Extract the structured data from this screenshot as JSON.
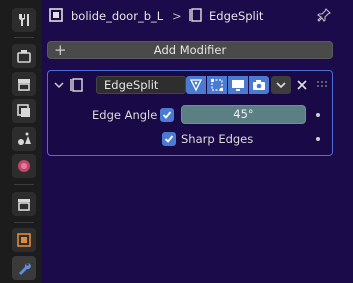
{
  "header": {
    "object_name": "bolide_door_b_L",
    "breadcrumb_separator": ">",
    "modifier_name": "EdgeSplit"
  },
  "toolbar": {
    "add_modifier_label": "Add Modifier"
  },
  "modifier": {
    "name": "EdgeSplit",
    "edge_angle_label": "Edge Angle",
    "edge_angle_enabled": true,
    "edge_angle_value": "45°",
    "sharp_edges_label": "Sharp Edges",
    "sharp_edges_enabled": true
  },
  "sidebar": {
    "tabs": [
      {
        "icon": "tool-icon"
      },
      {
        "icon": "render-icon"
      },
      {
        "icon": "output-icon"
      },
      {
        "icon": "view-layer-icon"
      },
      {
        "icon": "scene-icon"
      },
      {
        "icon": "world-icon"
      },
      {
        "icon": "collection-icon"
      },
      {
        "icon": "object-icon"
      },
      {
        "icon": "modifier-wrench-icon",
        "active": true
      }
    ]
  },
  "colors": {
    "panel_background": "#1b0b4a",
    "accent_blue": "#4a7bd1",
    "panel_border": "#4f6fd6",
    "value_field": "#5b7f83"
  }
}
